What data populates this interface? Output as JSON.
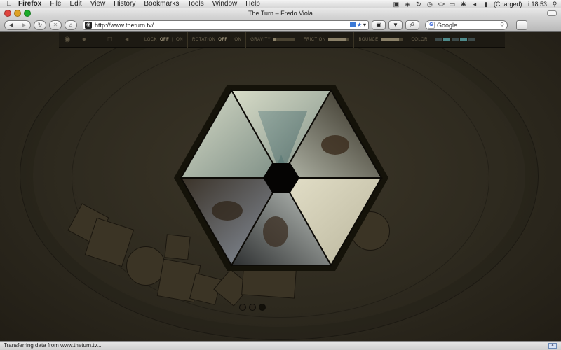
{
  "menubar": {
    "app": "Firefox",
    "items": [
      "File",
      "Edit",
      "View",
      "History",
      "Bookmarks",
      "Tools",
      "Window",
      "Help"
    ],
    "battery_status": "(Charged)",
    "clock": "ti 18.53"
  },
  "window": {
    "title": "The Turn – Fredo Viola"
  },
  "navbar": {
    "url": "http://www.theturn.tv/",
    "search_placeholder": "Google"
  },
  "site_toolbar": {
    "lock_label": "LOCK",
    "lock_off": "OFF",
    "lock_on": "ON",
    "rotation_label": "ROTATION",
    "rotation_off": "OFF",
    "rotation_on": "ON",
    "gravity_label": "GRAVITY",
    "friction_label": "FRICTION",
    "bounce_label": "BOUNCE",
    "color_label": "COLOR",
    "gravity_level": 0.15,
    "friction_level": 0.85,
    "bounce_level": 0.85
  },
  "status": {
    "text": "Transferring data from www.theturn.tv..."
  },
  "colors": {
    "page_bg": "#2e2a1f",
    "hex_frame": "#1a1810"
  },
  "icons": {
    "back": "back-arrow-icon",
    "forward": "forward-arrow-icon",
    "reload": "reload-icon",
    "stop": "stop-icon",
    "home": "home-icon"
  }
}
